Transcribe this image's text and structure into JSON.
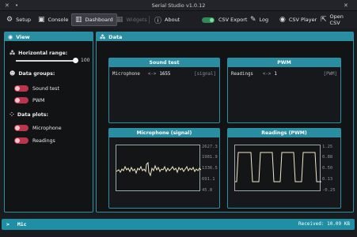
{
  "window": {
    "title": "Serial Studio v1.0.12"
  },
  "toolbar": {
    "setup": "Setup",
    "console": "Console",
    "dashboard": "Dashboard",
    "widgets": "Widgets",
    "about": "About",
    "csv_export": "CSV Export",
    "log": "Log",
    "csv_player": "CSV Player",
    "open_csv": "Open CSV"
  },
  "view_panel": {
    "title": "View",
    "horizontal_range_label": "Horizontal range:",
    "horizontal_range_value": "100",
    "data_groups_label": "Data groups:",
    "groups": [
      "Sound test",
      "PWM"
    ],
    "data_plots_label": "Data plots:",
    "plots": [
      "Microphone",
      "Readings"
    ]
  },
  "data_panel": {
    "title": "Data",
    "sound_test": {
      "title": "Sound test",
      "name": "Microphone",
      "arrow": "<->",
      "value": "1655",
      "unit": "[signal]"
    },
    "pwm": {
      "title": "PWM",
      "name": "Readings",
      "arrow": "<->",
      "value": "1",
      "unit": "[PWM]"
    },
    "mic_plot": {
      "title": "Microphone (signal)",
      "ticks": [
        "2627.3",
        "1981.9",
        "1336.5",
        "691.1",
        "45.8"
      ]
    },
    "pwm_plot": {
      "title": "Readings (PWM)",
      "ticks": [
        "1.25",
        "0.88",
        "0.50",
        "0.13",
        "-0.25"
      ]
    }
  },
  "status": {
    "device": "Mic",
    "received": "Received: 10.09 KB"
  },
  "colors": {
    "accent": "#2a8ea2",
    "toggle_off": "#b8354c",
    "plot_line": "#f0ecd0"
  }
}
